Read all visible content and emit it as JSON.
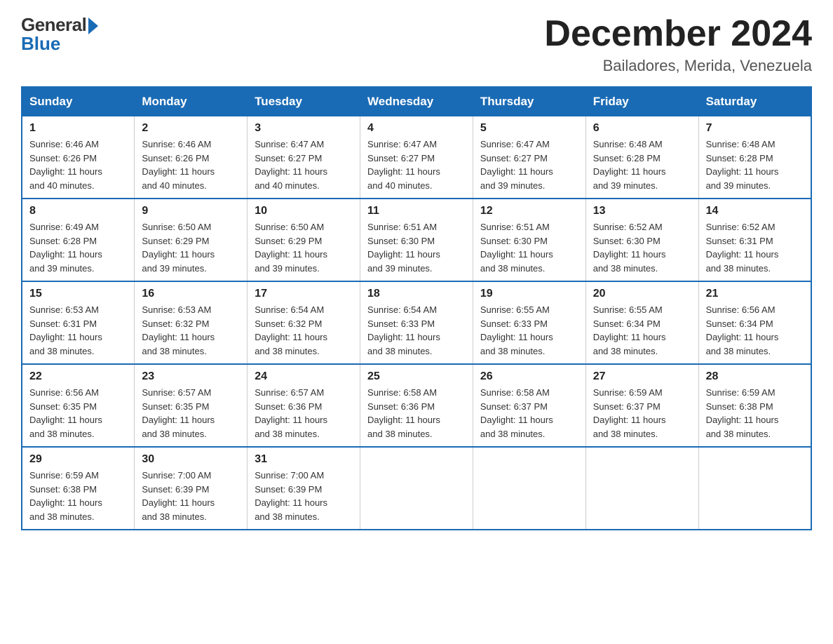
{
  "logo": {
    "general": "General",
    "blue": "Blue"
  },
  "title": "December 2024",
  "location": "Bailadores, Merida, Venezuela",
  "days_of_week": [
    "Sunday",
    "Monday",
    "Tuesday",
    "Wednesday",
    "Thursday",
    "Friday",
    "Saturday"
  ],
  "weeks": [
    [
      {
        "day": "1",
        "sunrise": "6:46 AM",
        "sunset": "6:26 PM",
        "daylight": "11 hours and 40 minutes."
      },
      {
        "day": "2",
        "sunrise": "6:46 AM",
        "sunset": "6:26 PM",
        "daylight": "11 hours and 40 minutes."
      },
      {
        "day": "3",
        "sunrise": "6:47 AM",
        "sunset": "6:27 PM",
        "daylight": "11 hours and 40 minutes."
      },
      {
        "day": "4",
        "sunrise": "6:47 AM",
        "sunset": "6:27 PM",
        "daylight": "11 hours and 40 minutes."
      },
      {
        "day": "5",
        "sunrise": "6:47 AM",
        "sunset": "6:27 PM",
        "daylight": "11 hours and 39 minutes."
      },
      {
        "day": "6",
        "sunrise": "6:48 AM",
        "sunset": "6:28 PM",
        "daylight": "11 hours and 39 minutes."
      },
      {
        "day": "7",
        "sunrise": "6:48 AM",
        "sunset": "6:28 PM",
        "daylight": "11 hours and 39 minutes."
      }
    ],
    [
      {
        "day": "8",
        "sunrise": "6:49 AM",
        "sunset": "6:28 PM",
        "daylight": "11 hours and 39 minutes."
      },
      {
        "day": "9",
        "sunrise": "6:50 AM",
        "sunset": "6:29 PM",
        "daylight": "11 hours and 39 minutes."
      },
      {
        "day": "10",
        "sunrise": "6:50 AM",
        "sunset": "6:29 PM",
        "daylight": "11 hours and 39 minutes."
      },
      {
        "day": "11",
        "sunrise": "6:51 AM",
        "sunset": "6:30 PM",
        "daylight": "11 hours and 39 minutes."
      },
      {
        "day": "12",
        "sunrise": "6:51 AM",
        "sunset": "6:30 PM",
        "daylight": "11 hours and 38 minutes."
      },
      {
        "day": "13",
        "sunrise": "6:52 AM",
        "sunset": "6:30 PM",
        "daylight": "11 hours and 38 minutes."
      },
      {
        "day": "14",
        "sunrise": "6:52 AM",
        "sunset": "6:31 PM",
        "daylight": "11 hours and 38 minutes."
      }
    ],
    [
      {
        "day": "15",
        "sunrise": "6:53 AM",
        "sunset": "6:31 PM",
        "daylight": "11 hours and 38 minutes."
      },
      {
        "day": "16",
        "sunrise": "6:53 AM",
        "sunset": "6:32 PM",
        "daylight": "11 hours and 38 minutes."
      },
      {
        "day": "17",
        "sunrise": "6:54 AM",
        "sunset": "6:32 PM",
        "daylight": "11 hours and 38 minutes."
      },
      {
        "day": "18",
        "sunrise": "6:54 AM",
        "sunset": "6:33 PM",
        "daylight": "11 hours and 38 minutes."
      },
      {
        "day": "19",
        "sunrise": "6:55 AM",
        "sunset": "6:33 PM",
        "daylight": "11 hours and 38 minutes."
      },
      {
        "day": "20",
        "sunrise": "6:55 AM",
        "sunset": "6:34 PM",
        "daylight": "11 hours and 38 minutes."
      },
      {
        "day": "21",
        "sunrise": "6:56 AM",
        "sunset": "6:34 PM",
        "daylight": "11 hours and 38 minutes."
      }
    ],
    [
      {
        "day": "22",
        "sunrise": "6:56 AM",
        "sunset": "6:35 PM",
        "daylight": "11 hours and 38 minutes."
      },
      {
        "day": "23",
        "sunrise": "6:57 AM",
        "sunset": "6:35 PM",
        "daylight": "11 hours and 38 minutes."
      },
      {
        "day": "24",
        "sunrise": "6:57 AM",
        "sunset": "6:36 PM",
        "daylight": "11 hours and 38 minutes."
      },
      {
        "day": "25",
        "sunrise": "6:58 AM",
        "sunset": "6:36 PM",
        "daylight": "11 hours and 38 minutes."
      },
      {
        "day": "26",
        "sunrise": "6:58 AM",
        "sunset": "6:37 PM",
        "daylight": "11 hours and 38 minutes."
      },
      {
        "day": "27",
        "sunrise": "6:59 AM",
        "sunset": "6:37 PM",
        "daylight": "11 hours and 38 minutes."
      },
      {
        "day": "28",
        "sunrise": "6:59 AM",
        "sunset": "6:38 PM",
        "daylight": "11 hours and 38 minutes."
      }
    ],
    [
      {
        "day": "29",
        "sunrise": "6:59 AM",
        "sunset": "6:38 PM",
        "daylight": "11 hours and 38 minutes."
      },
      {
        "day": "30",
        "sunrise": "7:00 AM",
        "sunset": "6:39 PM",
        "daylight": "11 hours and 38 minutes."
      },
      {
        "day": "31",
        "sunrise": "7:00 AM",
        "sunset": "6:39 PM",
        "daylight": "11 hours and 38 minutes."
      },
      null,
      null,
      null,
      null
    ]
  ],
  "labels": {
    "sunrise": "Sunrise: ",
    "sunset": "Sunset: ",
    "daylight": "Daylight: "
  }
}
